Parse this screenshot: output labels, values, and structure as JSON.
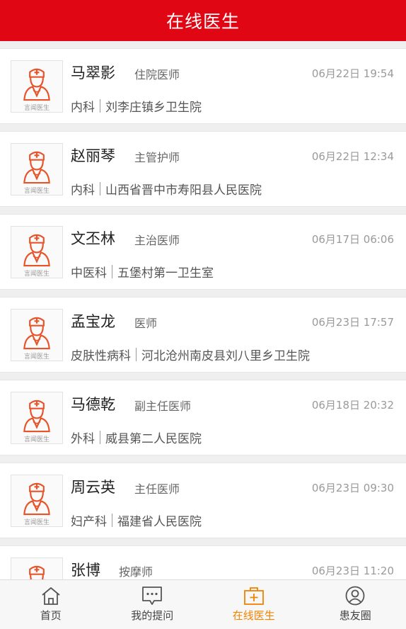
{
  "header": {
    "title": "在线医生"
  },
  "avatar_caption": "言闻医生",
  "doctors": [
    {
      "name": "马翠影",
      "title": "住院医师",
      "time": "06月22日 19:54",
      "dept": "内科",
      "hospital": "刘李庄镇乡卫生院"
    },
    {
      "name": "赵丽琴",
      "title": "主管护师",
      "time": "06月22日 12:34",
      "dept": "内科",
      "hospital": "山西省晋中市寿阳县人民医院"
    },
    {
      "name": "文丕林",
      "title": "主治医师",
      "time": "06月17日 06:06",
      "dept": "中医科",
      "hospital": "五堡村第一卫生室"
    },
    {
      "name": "孟宝龙",
      "title": "医师",
      "time": "06月23日 17:57",
      "dept": "皮肤性病科",
      "hospital": "河北沧州南皮县刘八里乡卫生院"
    },
    {
      "name": "马德乾",
      "title": "副主任医师",
      "time": "06月18日 20:32",
      "dept": "外科",
      "hospital": "威县第二人民医院"
    },
    {
      "name": "周云英",
      "title": "主任医师",
      "time": "06月23日 09:30",
      "dept": "妇产科",
      "hospital": "福建省人民医院"
    },
    {
      "name": "张博",
      "title": "按摩师",
      "time": "06月23日 11:20",
      "dept": "",
      "hospital": ""
    }
  ],
  "tabs": [
    {
      "label": "首页",
      "icon": "home-icon"
    },
    {
      "label": "我的提问",
      "icon": "chat-icon"
    },
    {
      "label": "在线医生",
      "icon": "medical-kit-icon"
    },
    {
      "label": "患友圈",
      "icon": "user-circle-icon"
    }
  ],
  "colors": {
    "header": "#e10613",
    "active_tab": "#f08300",
    "avatar_icon": "#e8542a"
  }
}
